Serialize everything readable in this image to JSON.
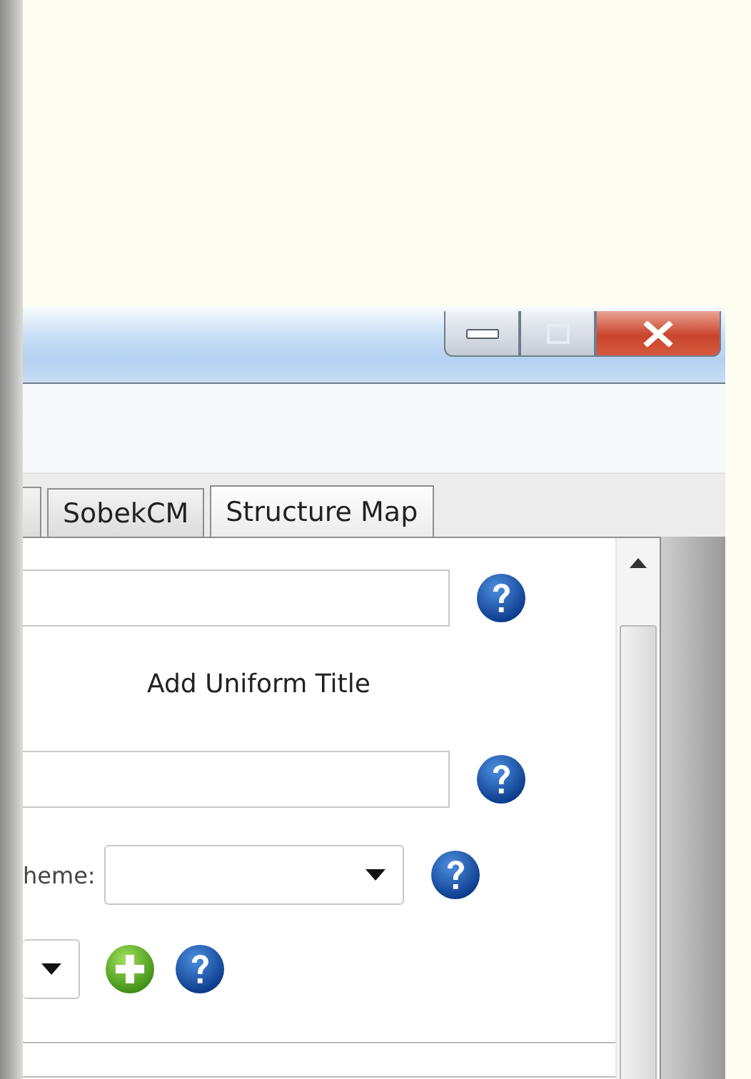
{
  "window": {
    "controls": [
      {
        "kind": "minimize"
      },
      {
        "kind": "maximize"
      },
      {
        "kind": "close"
      }
    ]
  },
  "tabs": [
    {
      "label": "SobekCM",
      "selected": false
    },
    {
      "label": "Structure Map",
      "selected": true
    }
  ],
  "rows": [
    {
      "kind": "text"
    },
    {
      "kind": "link",
      "label": "Add Uniform Title"
    },
    {
      "kind": "text"
    },
    {
      "kind": "select",
      "label": "heme:"
    },
    {
      "kind": "select-add"
    }
  ]
}
